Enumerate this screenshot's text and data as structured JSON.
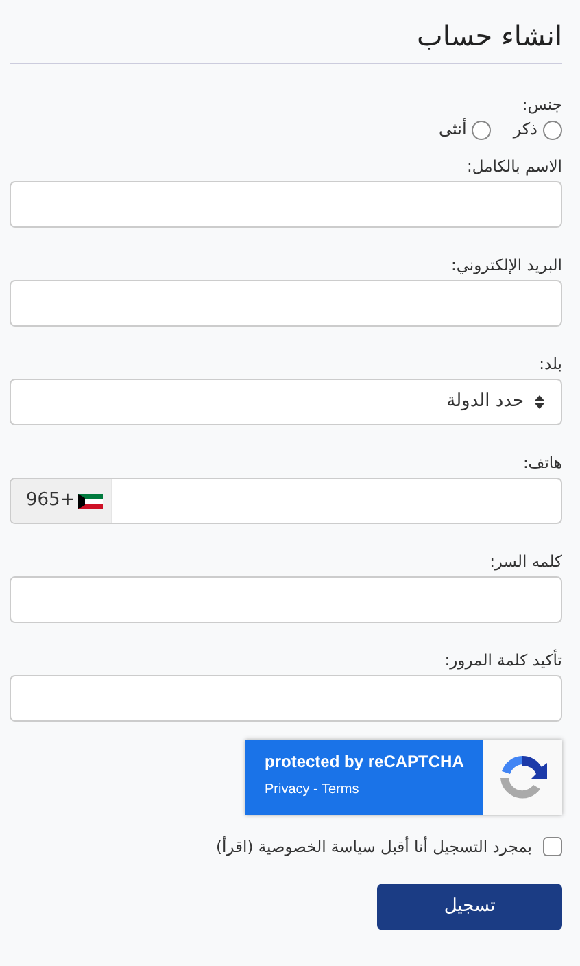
{
  "title": "انشاء حساب",
  "gender": {
    "label": "جنس:",
    "options": [
      {
        "label": "ذكر",
        "selected": false
      },
      {
        "label": "أنثى",
        "selected": false
      }
    ]
  },
  "fields": [
    {
      "kind": "text",
      "label": "الاسم بالكامل:"
    },
    {
      "kind": "text",
      "label": "البريد الإلكتروني:"
    },
    {
      "kind": "select",
      "label": "بلد:",
      "value": "حدد الدولة"
    },
    {
      "kind": "phone",
      "label": "هاتف:",
      "code": "965+"
    },
    {
      "kind": "password",
      "label": "كلمه السر:"
    },
    {
      "kind": "password",
      "label": "تأكيد كلمة المرور:"
    }
  ],
  "recaptcha": {
    "text": "protected by reCAPTCHA",
    "links": [
      "Privacy - Terms"
    ]
  },
  "consent": {
    "label": "بمجرد التسجيل أنا أقبل سياسة الخصوصية (اقرأ)",
    "checked": false
  },
  "submit": "تسجيل"
}
